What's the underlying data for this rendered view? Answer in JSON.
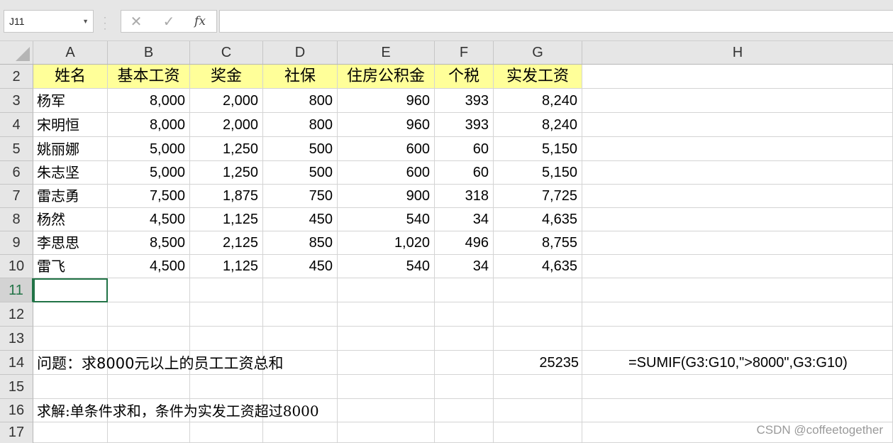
{
  "formula_bar": {
    "name_box": "J11",
    "cancel_icon": "✕",
    "enter_icon": "✓",
    "fx_label": "fx",
    "formula": ""
  },
  "columns": [
    "A",
    "B",
    "C",
    "D",
    "E",
    "F",
    "G",
    "H"
  ],
  "rows": [
    "2",
    "3",
    "4",
    "5",
    "6",
    "7",
    "8",
    "9",
    "10",
    "11",
    "12",
    "13",
    "14",
    "15",
    "16",
    "17"
  ],
  "active_row": "11",
  "table": {
    "headers": [
      "姓名",
      "基本工资",
      "奖金",
      "社保",
      "住房公积金",
      "个税",
      "实发工资"
    ],
    "data": [
      [
        "杨军",
        "8,000",
        "2,000",
        "800",
        "960",
        "393",
        "8,240"
      ],
      [
        "宋明恒",
        "8,000",
        "2,000",
        "800",
        "960",
        "393",
        "8,240"
      ],
      [
        "姚丽娜",
        "5,000",
        "1,250",
        "500",
        "600",
        "60",
        "5,150"
      ],
      [
        "朱志坚",
        "5,000",
        "1,250",
        "500",
        "600",
        "60",
        "5,150"
      ],
      [
        "雷志勇",
        "7,500",
        "1,875",
        "750",
        "900",
        "318",
        "7,725"
      ],
      [
        "杨然",
        "4,500",
        "1,125",
        "450",
        "540",
        "34",
        "4,635"
      ],
      [
        "李思思",
        "8,500",
        "2,125",
        "850",
        "1,020",
        "496",
        "8,755"
      ],
      [
        "雷飞",
        "4,500",
        "1,125",
        "450",
        "540",
        "34",
        "4,635"
      ]
    ]
  },
  "question": "问题：求8000元以上的员工工资总和",
  "answer": "25235",
  "formula_text": "=SUMIF(G3:G10,\">8000\",G3:G10)",
  "solution": "求解:单条件求和，条件为实发工资超过8000",
  "watermark": "CSDN @coffeetogether"
}
